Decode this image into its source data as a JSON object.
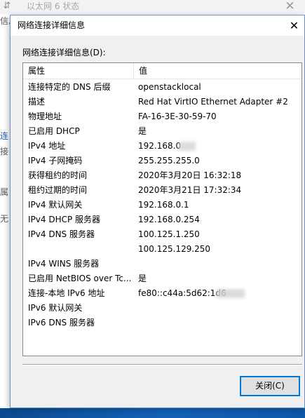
{
  "background_window": {
    "title": "以太网 6 状态",
    "close_symbol": "✕",
    "edge_fragments": [
      "信息",
      "连",
      "接",
      "属",
      "无"
    ],
    "icon": "network-adapter-icon"
  },
  "dialog": {
    "title": "网络连接详细信息",
    "close_symbol": "✕",
    "details_label": "网络连接详细信息(D):",
    "columns": {
      "property": "属性",
      "value": "值"
    },
    "rows": [
      {
        "property": "连接特定的 DNS 后缀",
        "value": "openstacklocal"
      },
      {
        "property": "描述",
        "value": "Red Hat VirtIO Ethernet Adapter #2"
      },
      {
        "property": "物理地址",
        "value": "FA-16-3E-30-59-70"
      },
      {
        "property": "已启用 DHCP",
        "value": "是"
      },
      {
        "property": "IPv4 地址",
        "value": "192.168.0"
      },
      {
        "property": "IPv4 子网掩码",
        "value": "255.255.255.0"
      },
      {
        "property": "获得租约的时间",
        "value": "2020年3月20日 16:32:18"
      },
      {
        "property": "租约过期的时间",
        "value": "2020年3月21日 17:32:34"
      },
      {
        "property": "IPv4 默认网关",
        "value": "192.168.0.1"
      },
      {
        "property": "IPv4 DHCP 服务器",
        "value": "192.168.0.254"
      },
      {
        "property": "IPv4 DNS 服务器",
        "value": "100.125.1.250"
      },
      {
        "property": "",
        "value": "100.125.129.250"
      },
      {
        "property": "IPv4 WINS 服务器",
        "value": ""
      },
      {
        "property": "已启用 NetBIOS over Tc...",
        "value": "是"
      },
      {
        "property": "连接-本地 IPv6 地址",
        "value": "fe80::c44a:5d62:1d6"
      },
      {
        "property": "IPv6 默认网关",
        "value": ""
      },
      {
        "property": "IPv6 DNS 服务器",
        "value": ""
      }
    ],
    "close_button_label": "关闭(C)"
  },
  "colors": {
    "dialog_background": "#f0f0f0",
    "dialog_border": "#6e8fc1",
    "button_focus_border": "#0078d7",
    "taskbar": "#1362b8"
  }
}
